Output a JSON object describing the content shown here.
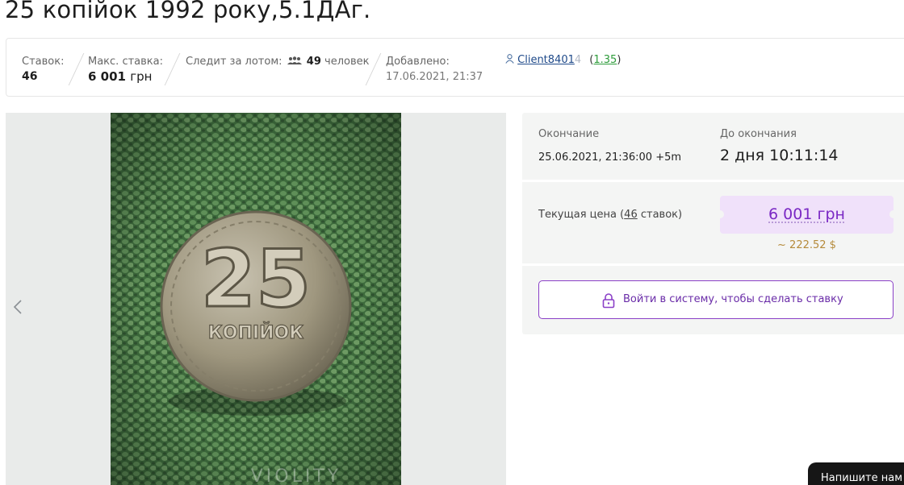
{
  "lot": {
    "title": "25 копійок 1992 року,5.1ДАг."
  },
  "info": {
    "bids_label": "Ставок:",
    "bids_value": "46",
    "max_bid_label": "Макс. ставка:",
    "max_bid_value": "6 001",
    "max_bid_currency": "грн",
    "followers_label": "Следит за лотом:",
    "followers_count": "49",
    "followers_unit": "человек",
    "added_label": "Добавлено:",
    "added_value": "17.06.2021, 21:37",
    "seller_name": "Client8401",
    "seller_name_faded": "4",
    "seller_rating": "1.35",
    "rating_open": "(",
    "rating_close": ")"
  },
  "gallery": {
    "coin_value": "25",
    "coin_word": "КОПІЙОК",
    "watermark": "VIOLITY"
  },
  "auction": {
    "end_label": "Окончание",
    "end_value": "25.06.2021, 21:36:00 +5m",
    "remaining_label": "До окончания",
    "remaining_value": "2 дня 10:11:14",
    "current_price_label": "Текущая цена (",
    "current_price_bids": "46",
    "current_price_suffix": " ставок)",
    "price": "6 001 грн",
    "price_usd": "~ 222.52 $",
    "login_button": "Войти в систему, чтобы сделать ставку"
  },
  "chat": {
    "label": "Напишите нам"
  },
  "colors": {
    "accent_purple": "#7a28c4",
    "price_bg": "#f0e1fa",
    "rating_green": "#2e9c3b",
    "link_blue": "#1f4a8a"
  }
}
